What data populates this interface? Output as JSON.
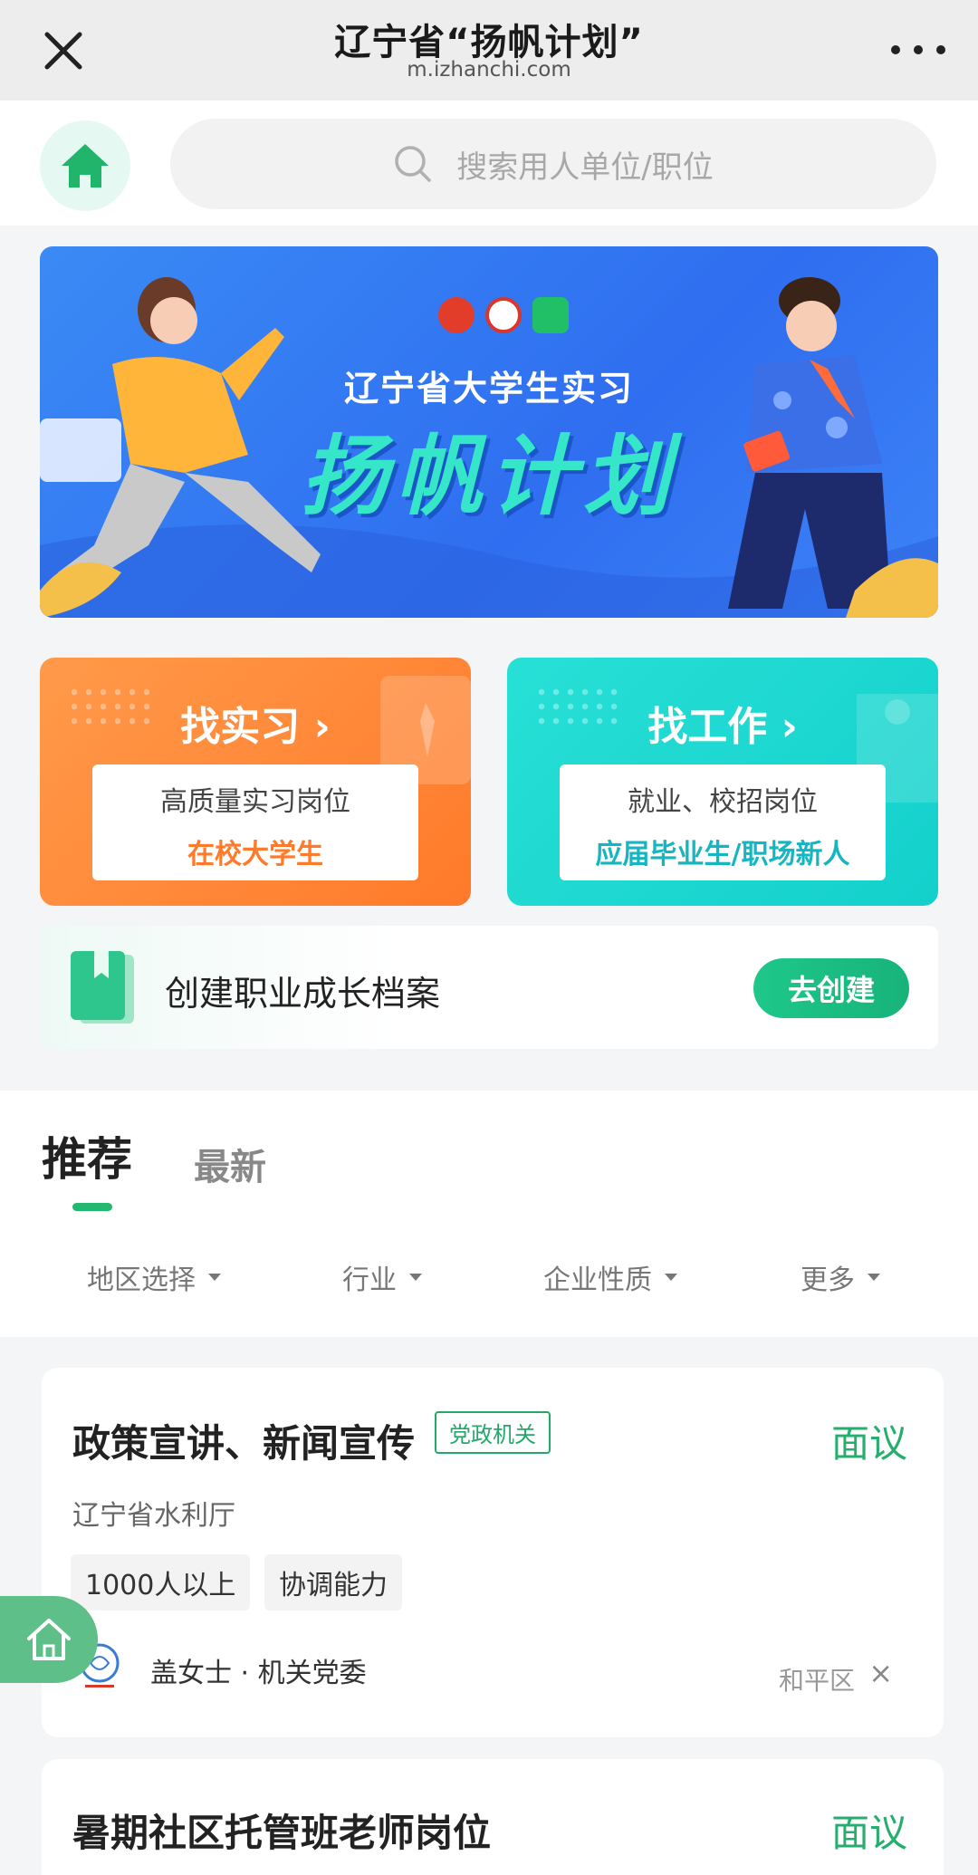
{
  "browser": {
    "title": "辽宁省“扬帆计划”",
    "url": "m.izhanchi.com"
  },
  "search": {
    "placeholder": "搜索用人单位/职位"
  },
  "banner": {
    "subtitle": "辽宁省大学生实习",
    "title": "扬帆计划"
  },
  "cards": [
    {
      "title": "找实习 ›",
      "line1": "高质量实习岗位",
      "line2": "在校大学生",
      "accent": "#ff7a2a"
    },
    {
      "title": "找工作 ›",
      "line1": "就业、校招岗位",
      "line2": "应届毕业生/职场新人",
      "accent": "#14c1c6"
    }
  ],
  "profile": {
    "text": "创建职业成长档案",
    "button": "去创建"
  },
  "tabs": {
    "active": "推荐",
    "other": "最新"
  },
  "filters": [
    "地区选择",
    "行业",
    "企业性质",
    "更多"
  ],
  "jobs": [
    {
      "title": "政策宣讲、新闻宣传",
      "badge": "党政机关",
      "salary": "面议",
      "company": "辽宁省水利厅",
      "tags": [
        "1000人以上",
        "协调能力"
      ],
      "contact": "盖女士 · 机关党委",
      "district": "和平区",
      "close": "×"
    },
    {
      "title": "暑期社区托管班老师岗位",
      "salary": "面议"
    }
  ],
  "colors": {
    "brand_green": "#23b870",
    "orange": "#ff7a2a",
    "cyan": "#14d0cc",
    "banner_blue": "#2f6ef0"
  }
}
